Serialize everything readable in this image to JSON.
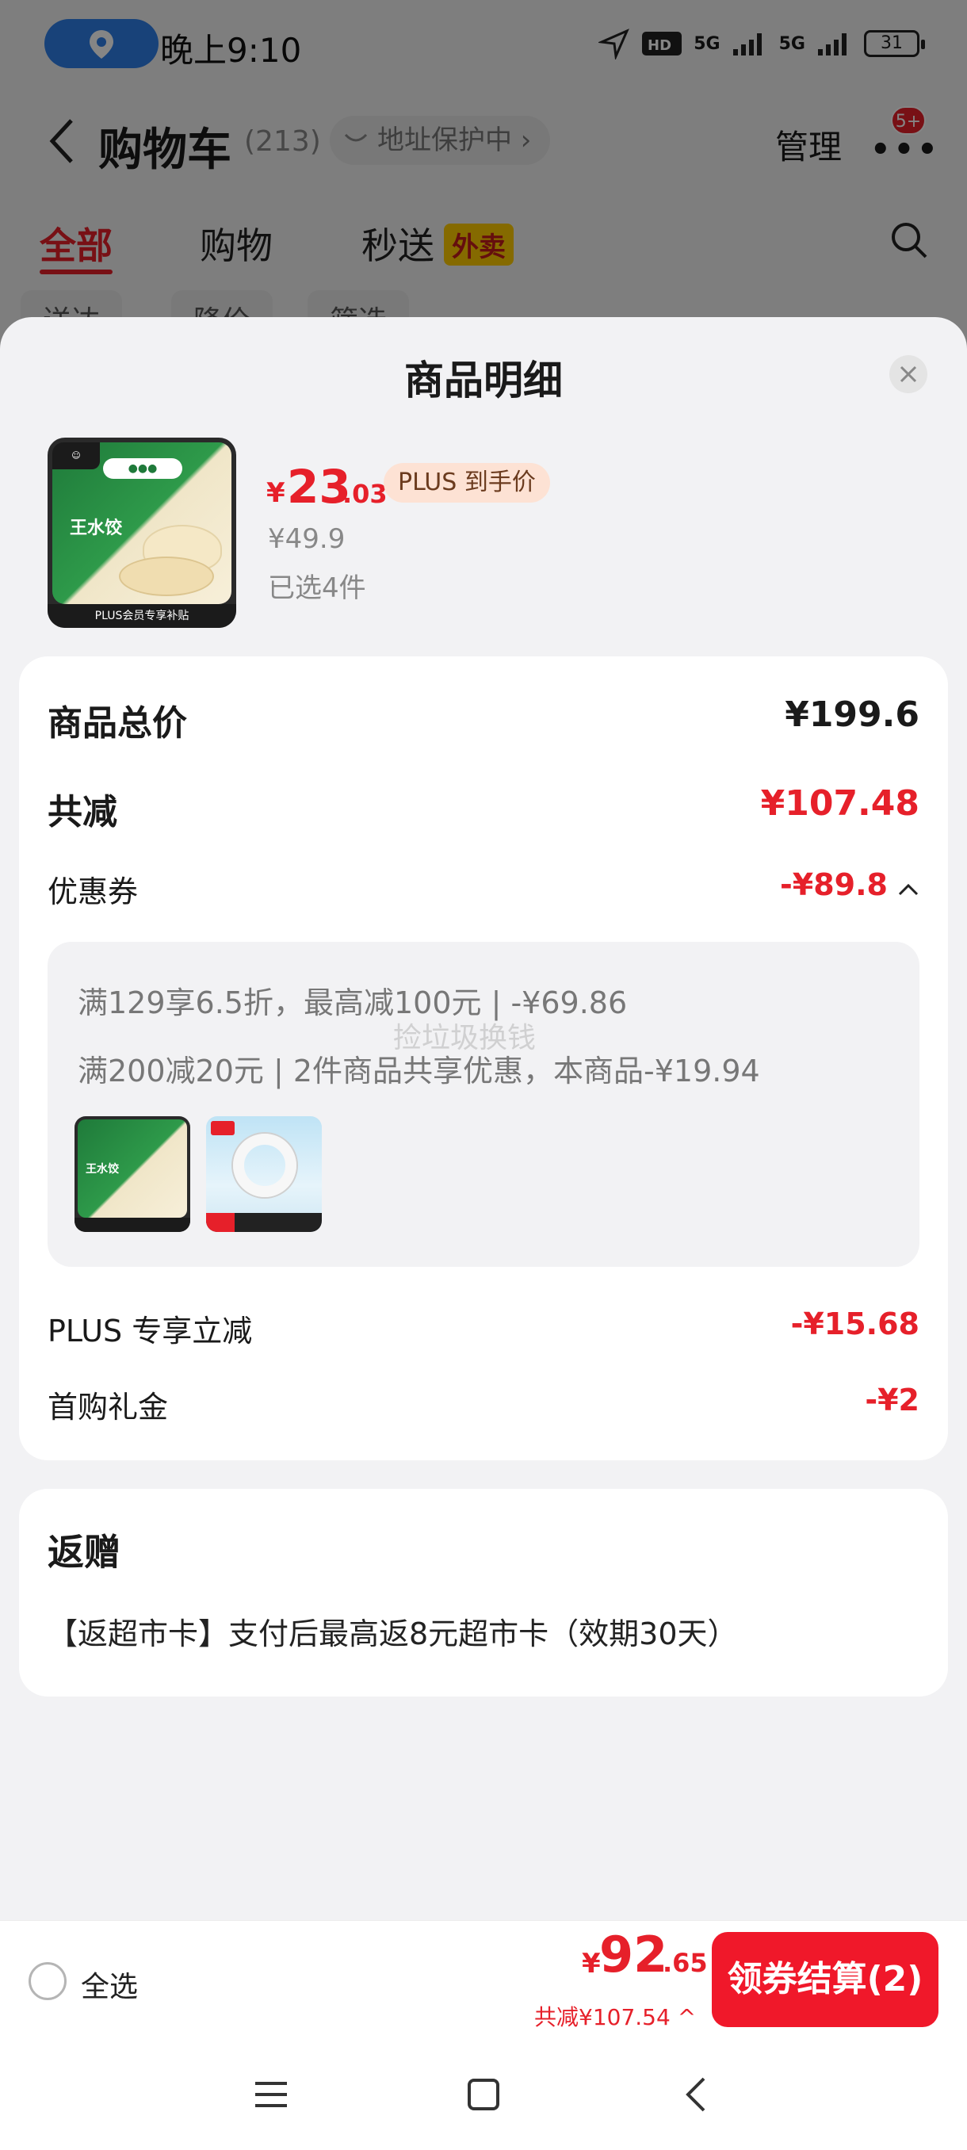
{
  "statusbar": {
    "time": "晚上9:10",
    "network": "5G",
    "battery": "31"
  },
  "nav": {
    "title": "购物车",
    "count": "(213)",
    "address_protect": "地址保护中 ›",
    "manage": "管理",
    "more_badge": "5+"
  },
  "tabs": {
    "all": "全部",
    "shopping": "购物",
    "delivery": "秒送",
    "delivery_badge": "外卖"
  },
  "filters": [
    "送达",
    "降价",
    "筛选"
  ],
  "sheet": {
    "title": "商品明细",
    "product": {
      "price_symbol": "¥",
      "price_int": "23",
      "price_dec": ".03",
      "price_tag": "PLUS 到手价",
      "original_price": "¥49.9",
      "selected_qty": "已选4件",
      "image_label": "王水饺",
      "image_footer": "PLUS会员专享补贴"
    },
    "summary": {
      "total_label": "商品总价",
      "total_value": "¥199.6",
      "reduce_label": "共减",
      "reduce_value": "¥107.48",
      "coupon_label": "优惠券",
      "coupon_value": "-¥89.8",
      "coupon_lines": [
        "满129享6.5折，最高减100元 | -¥69.86",
        "满200减20元 | 2件商品共享优惠，本商品-¥19.94"
      ],
      "watermark": "捡垃圾换钱",
      "plus_label": "PLUS 专享立减",
      "plus_value": "-¥15.68",
      "first_label": "首购礼金",
      "first_value": "-¥2"
    },
    "gift": {
      "title": "返赠",
      "text": "【返超市卡】支付后最高返8元超市卡（效期30天）"
    }
  },
  "bottom": {
    "select_all": "全选",
    "price_symbol": "¥",
    "price_int": "92",
    "price_dec": ".65",
    "saved": "共减¥107.54 ^",
    "checkout": "领券结算(2)"
  },
  "colors": {
    "accent": "#e6202a",
    "checkout": "#f0182a",
    "location_pill": "#2f7fe8"
  }
}
